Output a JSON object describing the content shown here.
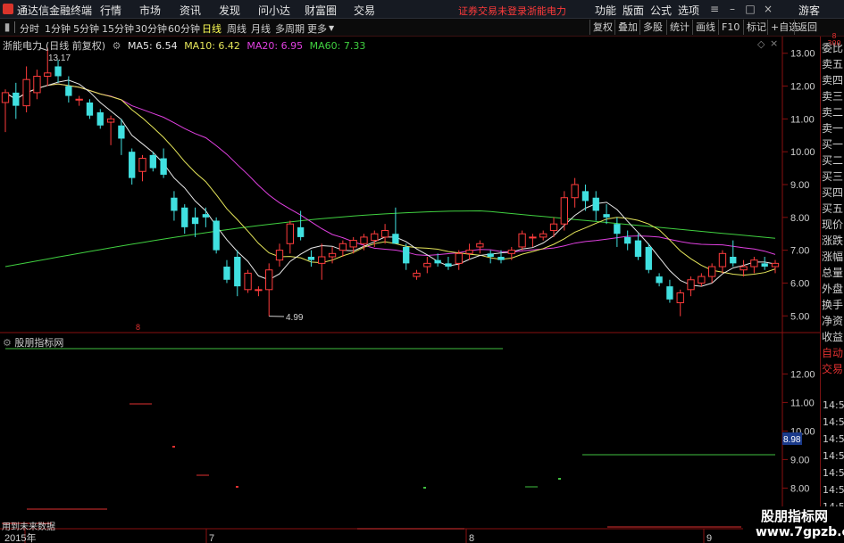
{
  "app": {
    "title": "通达信金融终端"
  },
  "menu": [
    "行情",
    "市场",
    "资讯",
    "发现",
    "问小达",
    "财富圈",
    "交易"
  ],
  "notice": {
    "trade": "证券交易未登录",
    "stock": "浙能电力"
  },
  "menu_right": [
    "功能",
    "版面",
    "公式",
    "选项"
  ],
  "guest": "游客",
  "periods": [
    "分时",
    "1分钟",
    "5分钟",
    "15分钟",
    "30分钟",
    "60分钟",
    "日线",
    "周线",
    "月线",
    "多周期",
    "更多"
  ],
  "active_period": "日线",
  "toolbar": [
    "复权",
    "叠加",
    "多股",
    "统计",
    "画线",
    "F10",
    "标记",
    "+自选",
    "返回"
  ],
  "main_chart": {
    "stock_name": "浙能电力",
    "period_note": "(日线 前复权)",
    "ma": [
      {
        "label": "MA5: 6.54",
        "color": "#e8e8e8"
      },
      {
        "label": "MA10: 6.42",
        "color": "#e6e65a"
      },
      {
        "label": "MA20: 6.95",
        "color": "#e040e0"
      },
      {
        "label": "MA60: 7.33",
        "color": "#40d040"
      }
    ],
    "high_label": "13.17",
    "low_label": "4.99",
    "axis_ticks": [
      "13.00",
      "12.00",
      "11.00",
      "10.00",
      "9.00",
      "8.00",
      "7.00",
      "6.00",
      "5.00"
    ],
    "top_mark": "8\n300"
  },
  "sub_chart": {
    "title": "股朋指标网",
    "axis_ticks": [
      "12.00",
      "11.00",
      "10.00",
      "9.00",
      "8.00",
      "7.00"
    ],
    "current_value": "8.98",
    "warning": "用到未来数据"
  },
  "x_axis": [
    "2015年",
    "7",
    "8",
    "9"
  ],
  "right_panel": {
    "labels": [
      "委比",
      "卖五",
      "卖四",
      "卖三",
      "卖二",
      "卖一",
      "买一",
      "买二",
      "买三",
      "买四",
      "买五",
      "现价",
      "涨跌",
      "涨幅",
      "总量",
      "外盘",
      "换手",
      "净资",
      "收益",
      "自动",
      "交易"
    ],
    "times": [
      "14:56",
      "14:56",
      "14:56",
      "14:56",
      "14:56",
      "14:56",
      "14:56",
      "14:56",
      "14:56",
      "14:56"
    ]
  },
  "watermark": {
    "line1": "股朋指标网",
    "line2": "www.7gpzb.com"
  },
  "colors": {
    "up": "#ff3c3c",
    "down": "#40e0e0",
    "ma5": "#e8e8e8",
    "ma10": "#e6e65a",
    "ma20": "#e040e0",
    "ma60": "#40d040",
    "axis": "#8a1010"
  },
  "chart_data": {
    "type": "candlestick",
    "title": "浙能电力 (日线 前复权)",
    "ylim": [
      4.6,
      13.4
    ],
    "ohlc": [
      [
        11.5,
        11.9,
        10.6,
        11.8
      ],
      [
        11.8,
        12.1,
        11.0,
        11.4
      ],
      [
        11.4,
        12.6,
        11.2,
        12.2
      ],
      [
        11.8,
        12.5,
        11.6,
        12.3
      ],
      [
        12.3,
        13.17,
        12.0,
        12.4
      ],
      [
        12.6,
        12.8,
        12.1,
        12.3
      ],
      [
        12.0,
        12.3,
        11.5,
        11.7
      ],
      [
        11.6,
        11.7,
        11.4,
        11.6
      ],
      [
        11.5,
        11.6,
        11.0,
        11.1
      ],
      [
        11.2,
        11.3,
        10.7,
        10.8
      ],
      [
        10.9,
        11.1,
        10.2,
        11.0
      ],
      [
        10.8,
        11.0,
        9.9,
        10.4
      ],
      [
        10.0,
        10.1,
        9.0,
        9.2
      ],
      [
        9.4,
        9.9,
        9.1,
        9.8
      ],
      [
        9.9,
        10.0,
        9.4,
        9.5
      ],
      [
        9.8,
        10.1,
        9.2,
        9.3
      ],
      [
        8.6,
        8.8,
        7.9,
        8.2
      ],
      [
        8.3,
        8.4,
        7.5,
        7.7
      ],
      [
        8.0,
        8.3,
        7.4,
        7.8
      ],
      [
        8.1,
        8.3,
        7.7,
        8.0
      ],
      [
        7.9,
        8.0,
        6.9,
        7.0
      ],
      [
        6.5,
        6.7,
        6.0,
        6.1
      ],
      [
        6.8,
        7.0,
        5.6,
        5.9
      ],
      [
        5.8,
        6.4,
        5.7,
        6.3
      ],
      [
        5.8,
        5.9,
        5.6,
        5.8
      ],
      [
        5.8,
        6.6,
        4.99,
        6.4
      ],
      [
        6.7,
        7.2,
        6.5,
        7.0
      ],
      [
        7.2,
        7.9,
        6.9,
        7.8
      ],
      [
        7.7,
        8.2,
        7.3,
        7.4
      ],
      [
        6.8,
        7.0,
        6.5,
        6.7
      ],
      [
        6.6,
        7.2,
        6.1,
        6.8
      ],
      [
        6.8,
        7.1,
        6.6,
        6.9
      ],
      [
        7.0,
        7.3,
        6.8,
        7.2
      ],
      [
        7.1,
        7.4,
        6.9,
        7.3
      ],
      [
        7.2,
        7.5,
        7.0,
        7.4
      ],
      [
        7.3,
        7.6,
        7.1,
        7.5
      ],
      [
        7.4,
        7.8,
        7.2,
        7.6
      ],
      [
        7.5,
        8.3,
        7.3,
        7.2
      ],
      [
        7.1,
        7.2,
        6.4,
        6.6
      ],
      [
        6.2,
        6.4,
        6.1,
        6.3
      ],
      [
        6.5,
        6.8,
        6.3,
        6.6
      ],
      [
        6.7,
        6.9,
        6.5,
        6.6
      ],
      [
        6.6,
        6.8,
        6.4,
        6.5
      ],
      [
        6.6,
        7.0,
        6.4,
        6.9
      ],
      [
        6.9,
        7.2,
        6.7,
        7.0
      ],
      [
        7.1,
        7.3,
        6.9,
        7.2
      ],
      [
        6.9,
        7.0,
        6.6,
        6.8
      ],
      [
        6.8,
        7.0,
        6.6,
        6.7
      ],
      [
        6.9,
        7.1,
        6.7,
        7.0
      ],
      [
        7.1,
        7.6,
        7.0,
        7.5
      ],
      [
        7.4,
        7.5,
        7.1,
        7.4
      ],
      [
        7.4,
        7.6,
        7.3,
        7.5
      ],
      [
        7.6,
        8.0,
        7.4,
        7.8
      ],
      [
        7.8,
        8.8,
        7.6,
        8.6
      ],
      [
        8.6,
        9.2,
        8.3,
        9.0
      ],
      [
        8.8,
        9.0,
        8.2,
        8.5
      ],
      [
        8.6,
        8.8,
        7.9,
        8.2
      ],
      [
        8.1,
        8.4,
        7.8,
        8.0
      ],
      [
        7.8,
        8.0,
        7.1,
        7.5
      ],
      [
        7.4,
        7.6,
        7.0,
        7.2
      ],
      [
        7.3,
        7.5,
        6.7,
        6.8
      ],
      [
        7.1,
        7.2,
        6.3,
        6.4
      ],
      [
        6.2,
        6.3,
        5.9,
        6.0
      ],
      [
        5.9,
        6.1,
        5.4,
        5.5
      ],
      [
        5.4,
        5.8,
        4.99,
        5.7
      ],
      [
        5.8,
        6.2,
        5.6,
        6.1
      ],
      [
        6.0,
        6.3,
        5.9,
        6.2
      ],
      [
        6.2,
        6.6,
        6.0,
        6.5
      ],
      [
        6.5,
        7.0,
        6.3,
        6.9
      ],
      [
        6.8,
        7.3,
        6.5,
        6.6
      ],
      [
        6.4,
        6.7,
        6.2,
        6.5
      ],
      [
        6.5,
        6.8,
        6.3,
        6.7
      ],
      [
        6.6,
        6.8,
        6.4,
        6.5
      ],
      [
        6.5,
        6.7,
        6.3,
        6.6
      ]
    ],
    "sub_series": {
      "name": "股朋指标网",
      "ylim": [
        6.7,
        13.2
      ]
    }
  }
}
